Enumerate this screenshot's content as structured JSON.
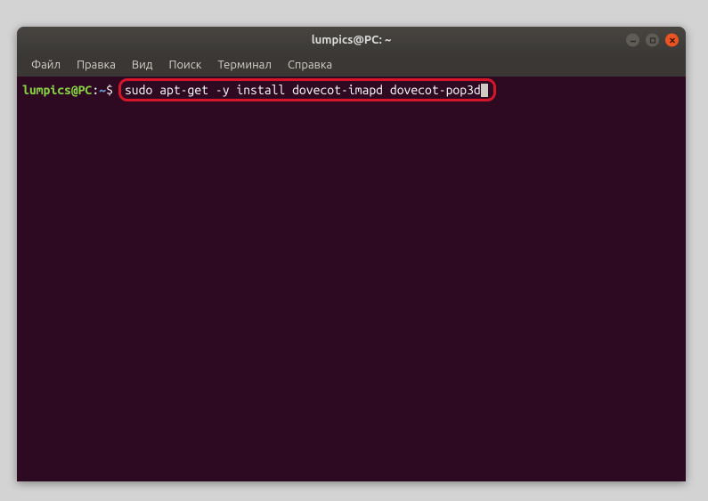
{
  "window": {
    "title": "lumpics@PC: ~"
  },
  "menubar": {
    "items": [
      {
        "label": "Файл"
      },
      {
        "label": "Правка"
      },
      {
        "label": "Вид"
      },
      {
        "label": "Поиск"
      },
      {
        "label": "Терминал"
      },
      {
        "label": "Справка"
      }
    ]
  },
  "terminal": {
    "prompt_user": "lumpics@PC",
    "prompt_colon": ":",
    "prompt_path": "~",
    "prompt_dollar": "$",
    "command": "sudo apt-get -y install dovecot-imapd dovecot-pop3d"
  }
}
